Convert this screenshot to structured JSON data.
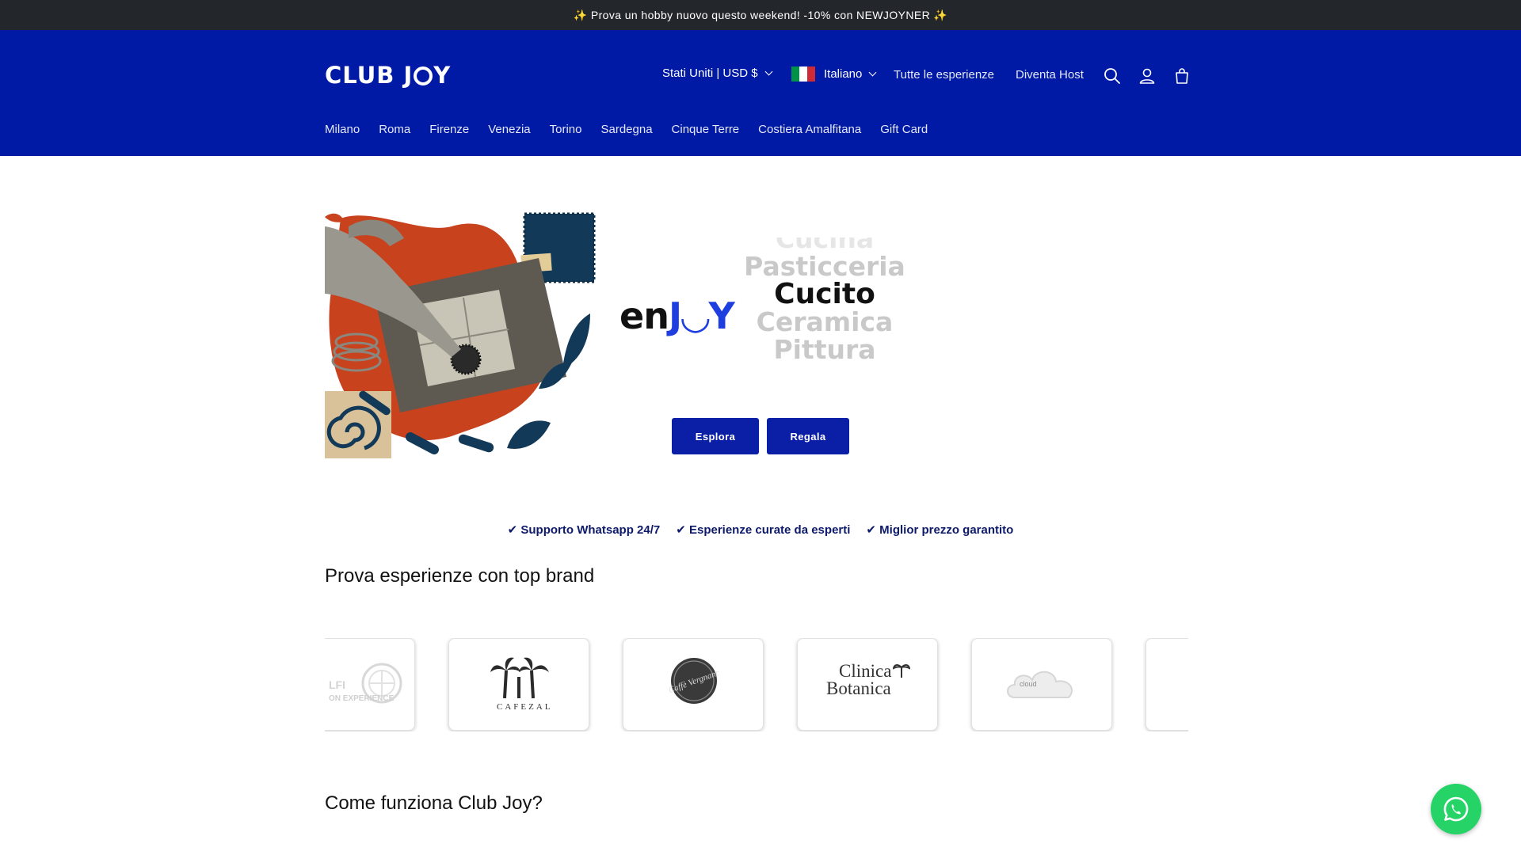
{
  "announcement": "✨ Prova un hobby nuovo questo weekend! -10% con NEWJOYNER ✨",
  "header": {
    "logo_left": "CLUB J",
    "logo_right": "Y",
    "country_selector": "Stati Uniti | USD $",
    "language_selector": "Italiano",
    "nav": [
      "Tutte le esperienze",
      "Diventa Host"
    ],
    "icons": [
      "search-icon",
      "account-icon",
      "cart-icon"
    ],
    "cities": [
      "Milano",
      "Roma",
      "Firenze",
      "Venezia",
      "Torino",
      "Sardegna",
      "Cinque Terre",
      "Costiera Amalfitana",
      "Gift Card"
    ]
  },
  "hero": {
    "enjoy_prefix": "en",
    "enjoy_suffix": "J◡Y",
    "words_above": [
      "Cucina",
      "Pasticceria"
    ],
    "word_current": "Cucito",
    "words_below": [
      "Ceramica",
      "Pittura"
    ],
    "buttons": [
      "Esplora",
      "Regala"
    ]
  },
  "usps": [
    "✔ Supporto Whatsapp 24/7",
    "✔ Esperienze curate da esperti",
    "✔ Miglior prezzo garantito"
  ],
  "brands_section": {
    "title": "Prova esperienze con top brand",
    "logos": [
      {
        "line1": "LFI",
        "line2": "ON EXPERIENCE"
      },
      {
        "line1": "CAFEZAL"
      },
      {
        "line1": "Caffè Vergnano"
      },
      {
        "line1": "Clinica",
        "line2": "Botanica"
      },
      {
        "line1": "cloud"
      }
    ]
  },
  "how_section": {
    "title": "Come funziona Club Joy?"
  },
  "colors": {
    "header_bg": "#001aa6",
    "announce_bg": "#23262b",
    "button_bg": "#0b1ea6",
    "whatsapp": "#25d366"
  }
}
